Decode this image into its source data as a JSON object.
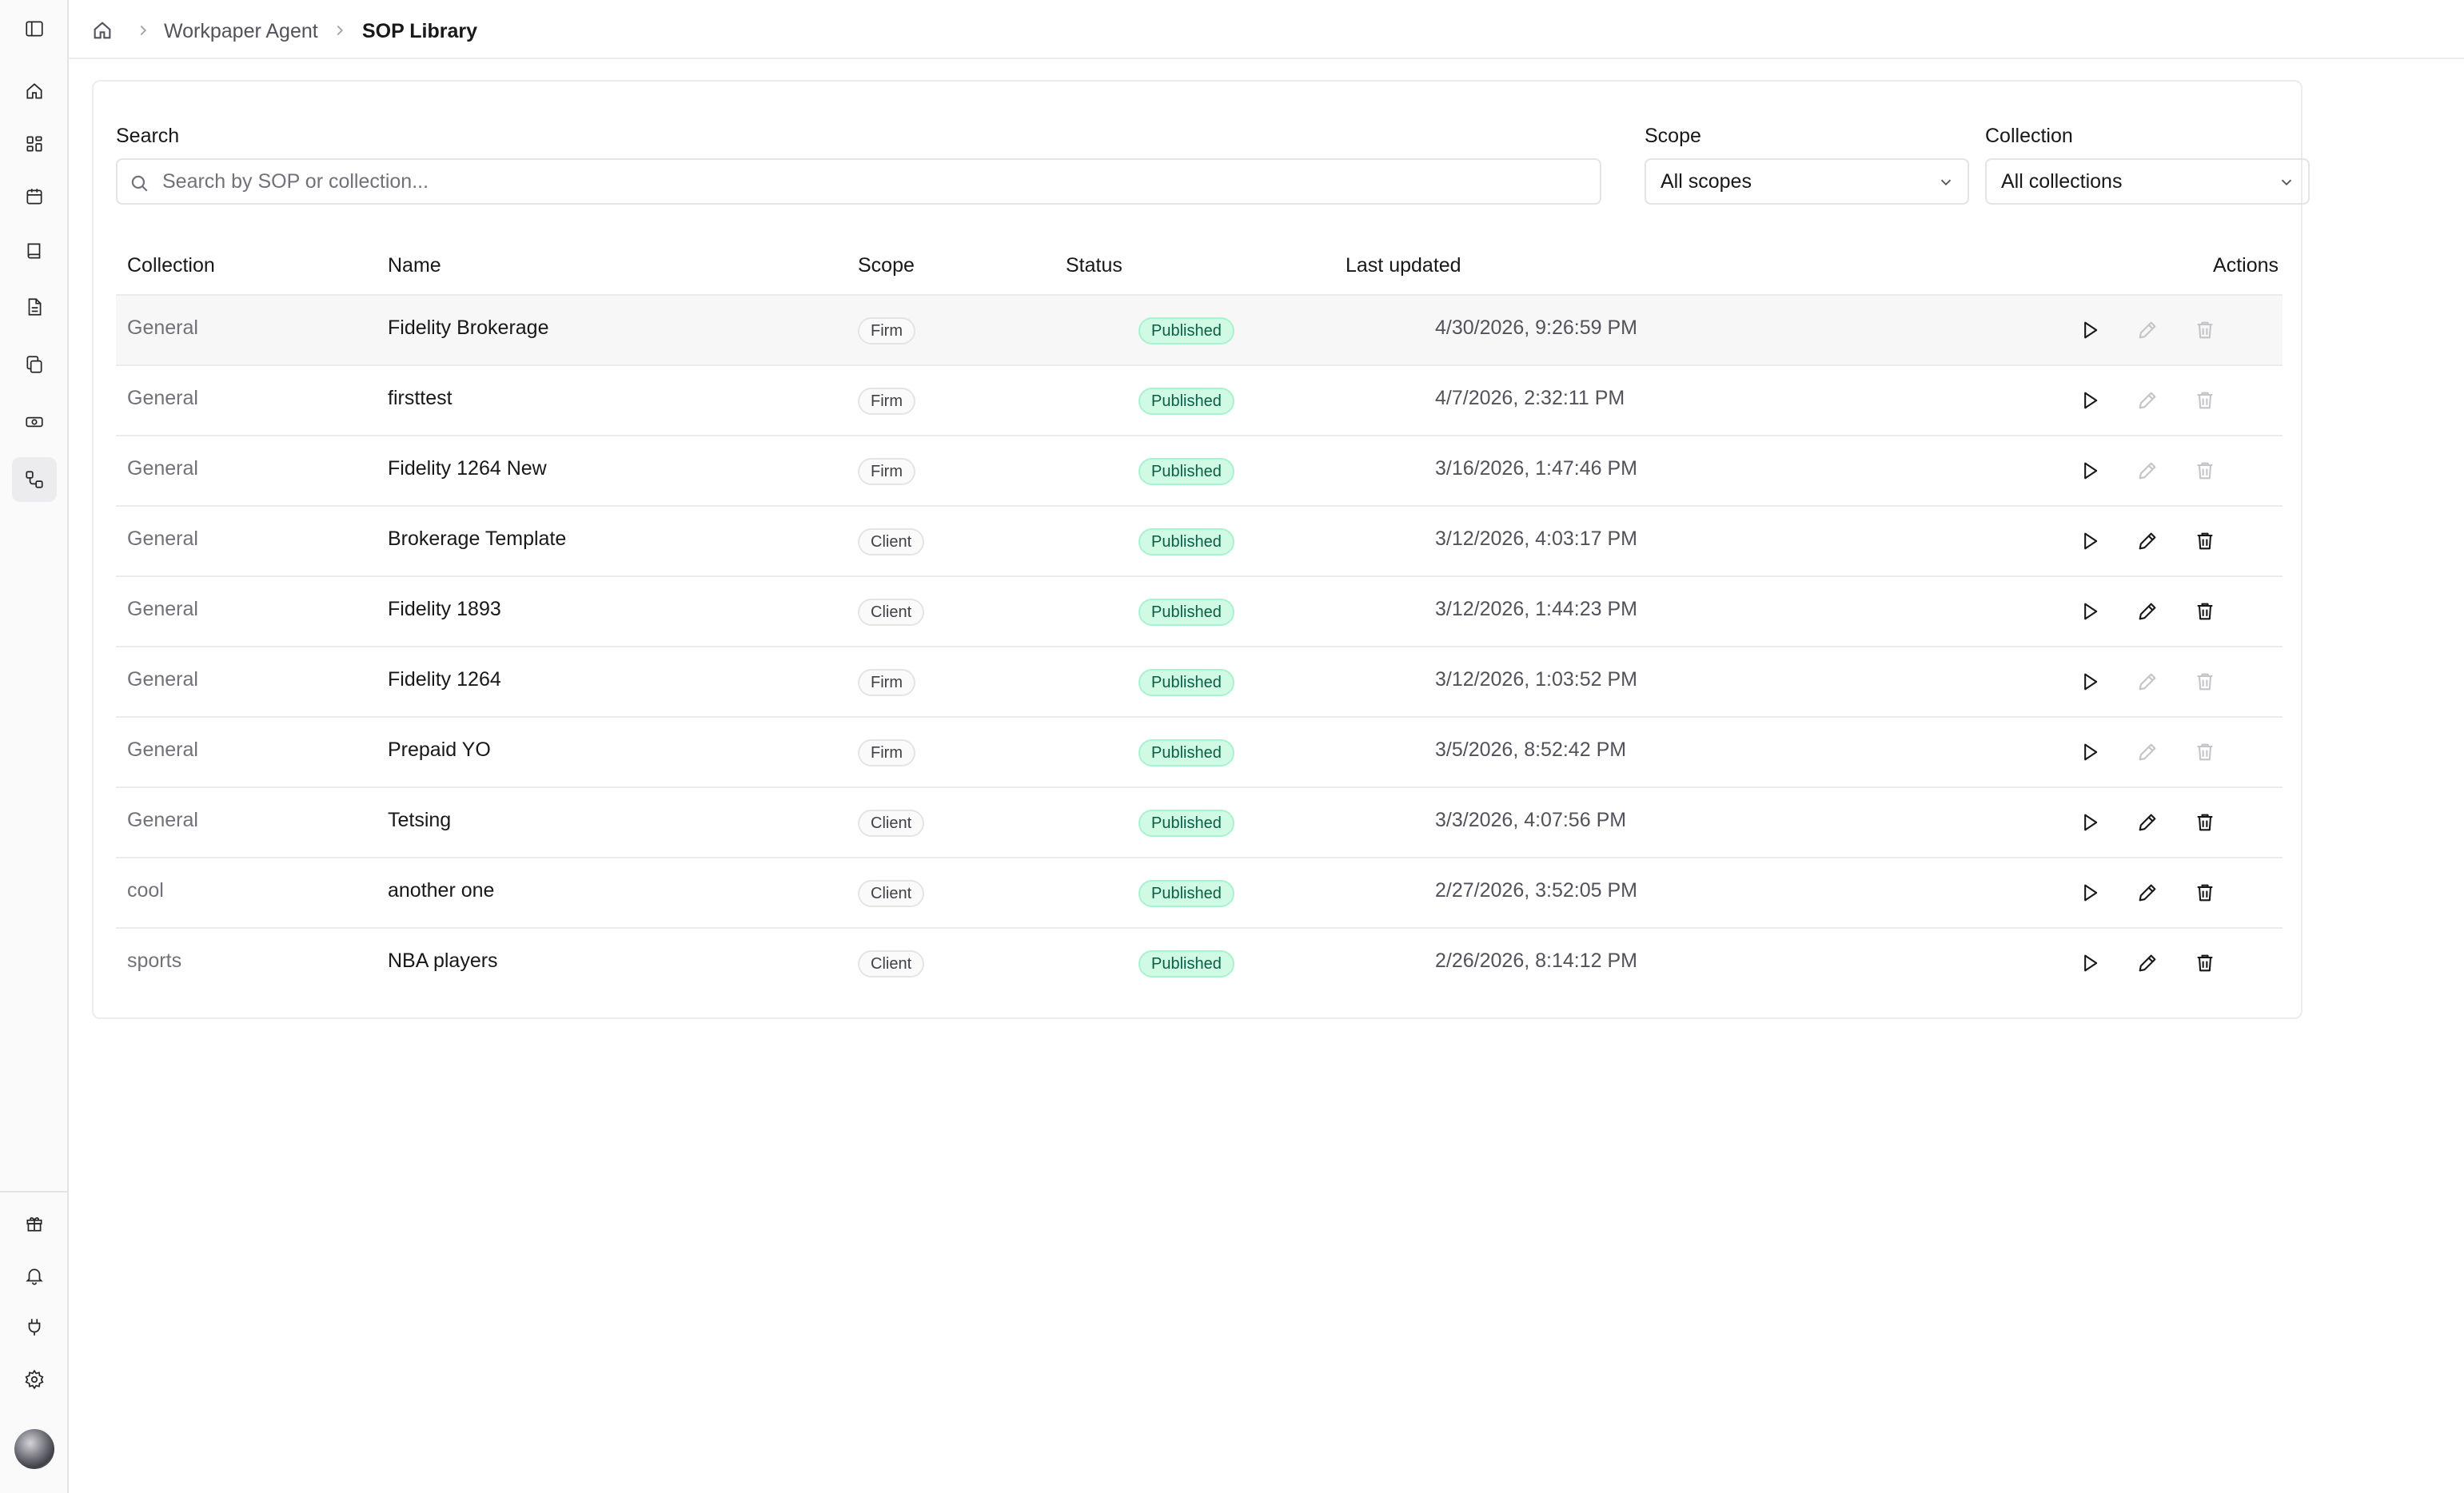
{
  "breadcrumb": {
    "home_icon": "home-icon",
    "items": [
      "Workpaper Agent",
      "SOP Library"
    ]
  },
  "sidebar": {
    "top_icons": [
      "panel-toggle-icon",
      "home-icon",
      "grid-icon",
      "calendar-icon",
      "book-icon",
      "document-icon",
      "copy-icon",
      "money-icon",
      "workflow-icon"
    ],
    "bottom_icons": [
      "gift-icon",
      "bell-icon",
      "plug-icon",
      "gear-icon"
    ],
    "active": "workflow-icon"
  },
  "filters": {
    "search_label": "Search",
    "search_placeholder": "Search by SOP or collection...",
    "search_value": "",
    "scope_label": "Scope",
    "scope_value": "All scopes",
    "collection_label": "Collection",
    "collection_value": "All collections"
  },
  "table": {
    "headers": {
      "collection": "Collection",
      "name": "Name",
      "scope": "Scope",
      "status": "Status",
      "last_updated": "Last updated",
      "actions": "Actions"
    },
    "rows": [
      {
        "collection": "General",
        "name": "Fidelity Brokerage",
        "scope": "Firm",
        "status": "Published",
        "last_updated": "4/30/2026, 9:26:59 PM",
        "editable": false
      },
      {
        "collection": "General",
        "name": "firsttest",
        "scope": "Firm",
        "status": "Published",
        "last_updated": "4/7/2026, 2:32:11 PM",
        "editable": false
      },
      {
        "collection": "General",
        "name": "Fidelity 1264 New",
        "scope": "Firm",
        "status": "Published",
        "last_updated": "3/16/2026, 1:47:46 PM",
        "editable": false
      },
      {
        "collection": "General",
        "name": "Brokerage Template",
        "scope": "Client",
        "status": "Published",
        "last_updated": "3/12/2026, 4:03:17 PM",
        "editable": true
      },
      {
        "collection": "General",
        "name": "Fidelity 1893",
        "scope": "Client",
        "status": "Published",
        "last_updated": "3/12/2026, 1:44:23 PM",
        "editable": true
      },
      {
        "collection": "General",
        "name": "Fidelity 1264",
        "scope": "Firm",
        "status": "Published",
        "last_updated": "3/12/2026, 1:03:52 PM",
        "editable": false
      },
      {
        "collection": "General",
        "name": "Prepaid YO",
        "scope": "Firm",
        "status": "Published",
        "last_updated": "3/5/2026, 8:52:42 PM",
        "editable": false
      },
      {
        "collection": "General",
        "name": "Tetsing",
        "scope": "Client",
        "status": "Published",
        "last_updated": "3/3/2026, 4:07:56 PM",
        "editable": true
      },
      {
        "collection": "cool",
        "name": "another one",
        "scope": "Client",
        "status": "Published",
        "last_updated": "2/27/2026, 3:52:05 PM",
        "editable": true
      },
      {
        "collection": "sports",
        "name": "NBA players",
        "scope": "Client",
        "status": "Published",
        "last_updated": "2/26/2026, 8:14:12 PM",
        "editable": true
      }
    ]
  },
  "colors": {
    "status_published_bg": "#d1fae5",
    "status_published_text": "#065f46",
    "disabled_icon": "#c4c4c9"
  }
}
